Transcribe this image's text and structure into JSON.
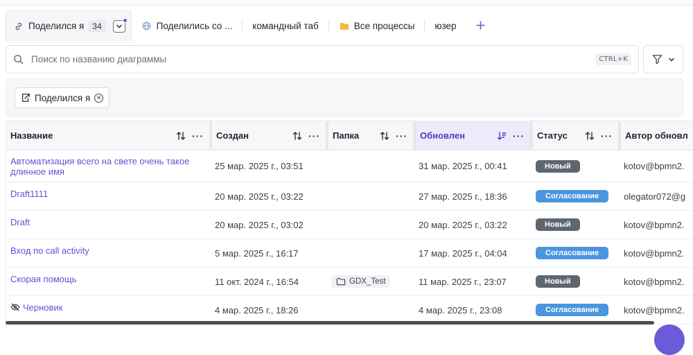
{
  "tabs": [
    {
      "label": "Поделился я",
      "badge": "34",
      "icon": "link-icon"
    },
    {
      "label": "Поделились со ...",
      "icon": "globe-icon"
    },
    {
      "label": "командный таб"
    },
    {
      "label": "Все процессы",
      "icon": "folder-icon"
    },
    {
      "label": "юзер"
    }
  ],
  "search": {
    "placeholder": "Поиск по названию диаграммы",
    "shortcut": "CTRL+K"
  },
  "filter_chip": {
    "label": "Поделился я"
  },
  "table": {
    "columns": [
      "Название",
      "Создан",
      "Папка",
      "Обновлен",
      "Статус",
      "Автор обновл"
    ],
    "rows": [
      {
        "name": "Автоматизация всего на свете очень такое длинное имя",
        "created": "25 мар. 2025 г., 03:51",
        "folder": "",
        "updated": "31 мар. 2025 г., 00:41",
        "status": "Новый",
        "author": "kotov@bpmn2."
      },
      {
        "name": "Draft1111",
        "created": "20 мар. 2025 г., 03:22",
        "folder": "",
        "updated": "27 мар. 2025 г., 18:36",
        "status": "Согласование",
        "author": "olegator072@g"
      },
      {
        "name": "Draft",
        "created": "20 мар. 2025 г., 03:02",
        "folder": "",
        "updated": "20 мар. 2025 г., 03:22",
        "status": "Новый",
        "author": "kotov@bpmn2."
      },
      {
        "name": "Вход по call activity",
        "created": "5 мар. 2025 г., 16:17",
        "folder": "",
        "updated": "17 мар. 2025 г., 04:04",
        "status": "Согласование",
        "author": "kotov@bpmn2."
      },
      {
        "name": "Скорая помощь",
        "created": "11 окт. 2024 г., 16:54",
        "folder": "GDX_Test",
        "updated": "11 мар. 2025 г., 23:07",
        "status": "Новый",
        "author": "kotov@bpmn2."
      },
      {
        "name": "Черновик",
        "created": "4 мар. 2025 г., 18:26",
        "folder": "",
        "updated": "4 мар. 2025 г., 23:08",
        "status": "Согласование",
        "author": "kotov@bpmn2."
      }
    ]
  },
  "colors": {
    "accent": "#6b5bd8",
    "status_new": "#5e6670",
    "status_approval": "#4a95e0",
    "link": "#6053d6"
  }
}
